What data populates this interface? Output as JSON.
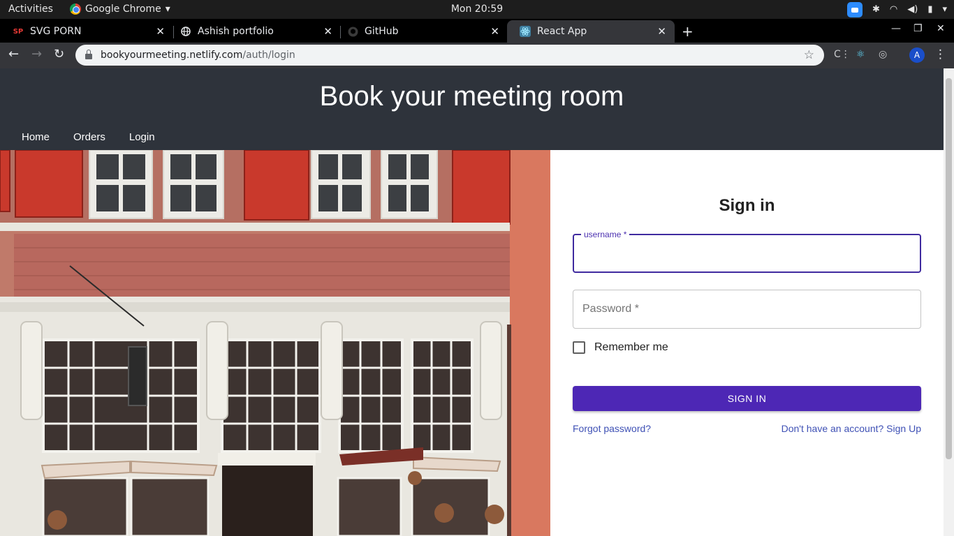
{
  "system_bar": {
    "activities": "Activities",
    "app_name": "Google Chrome",
    "clock": "Mon 20:59"
  },
  "tabs": [
    {
      "title": "SVG PORN",
      "favicon": "SP",
      "active": false
    },
    {
      "title": "Ashish portfolio",
      "favicon": "globe-icon",
      "active": false
    },
    {
      "title": "GitHub",
      "favicon": "github-icon",
      "active": false
    },
    {
      "title": "React App",
      "favicon": "react-icon",
      "active": true
    }
  ],
  "address_bar": {
    "host": "bookyourmeeting.netlify.com",
    "path": "/auth/login"
  },
  "profile_initial": "A",
  "site": {
    "title": "Book your meeting room",
    "nav": [
      "Home",
      "Orders",
      "Login"
    ]
  },
  "signin": {
    "heading": "Sign in",
    "username_label": "username *",
    "username_value": "",
    "password_placeholder": "Password *",
    "remember_label": "Remember me",
    "button_label": "SIGN IN",
    "forgot_link": "Forgot password?",
    "signup_link": "Don't have an account? Sign Up"
  },
  "colors": {
    "header_bg": "#2e333b",
    "primary_button": "#4d27b5",
    "focused_outline": "#3f2a9f",
    "link": "#3f51b5"
  }
}
